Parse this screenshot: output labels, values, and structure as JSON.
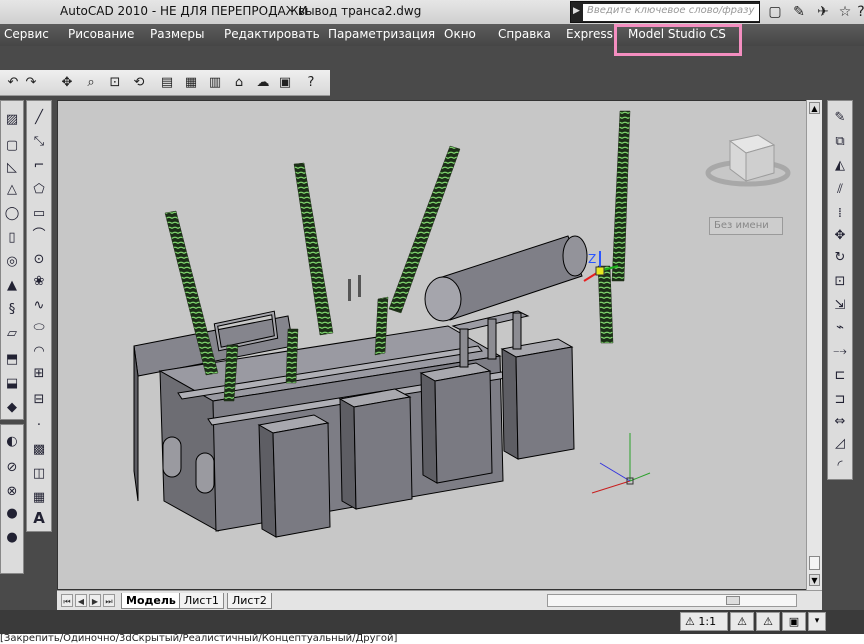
{
  "titlebar": {
    "app_title": "AutoCAD 2010 - НЕ ДЛЯ ПЕРЕПРОДАЖИ",
    "file_name": "вывод транса2.dwg",
    "search_placeholder": "Введите ключевое слово/фразу"
  },
  "menubar": {
    "items": [
      "Сервис",
      "Рисование",
      "Размеры",
      "Редактировать",
      "Параметризация",
      "Окно",
      "Справка",
      "Express",
      "Model Studio CS"
    ]
  },
  "highlight_color": "#f48ec0",
  "viewport": {
    "background": "#c7c7c7",
    "viewcube_label": "Без имени",
    "ucs_axes": [
      "X",
      "Y",
      "Z"
    ],
    "gizmo_label": "Z"
  },
  "layout_tabs": [
    "Модель",
    "Лист1",
    "Лист2"
  ],
  "active_tab": "Модель",
  "statusbar": {
    "scale": "1:1"
  },
  "command_line": "[Закрепить/Одиночно/3dСкрытый/Реалистичный/Концептуальный/Другой]"
}
